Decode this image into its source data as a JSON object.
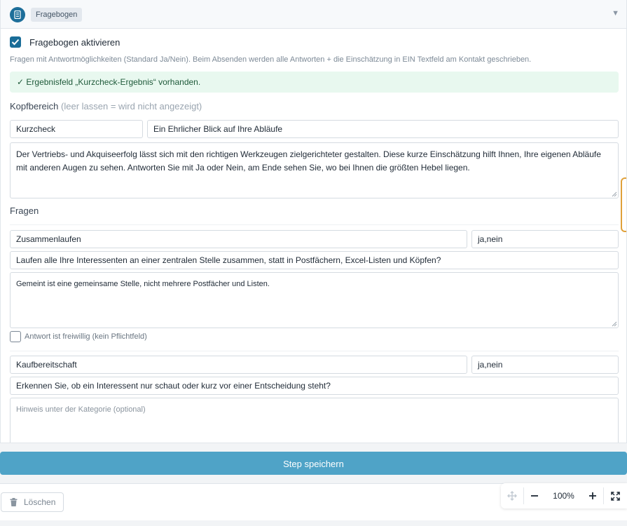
{
  "header": {
    "tag": "Fragebogen"
  },
  "activate": {
    "label": "Fragebogen aktivieren",
    "checked": true
  },
  "hint": "Fragen mit Antwortmöglichkeiten (Standard Ja/Nein). Beim Absenden werden alle Antworten + die Einschätzung in EIN Textfeld am Kontakt geschrieben.",
  "success": "✓ Ergebnisfeld „Kurzcheck-Ergebnis“ vorhanden.",
  "head_section": {
    "title": "Kopfbereich",
    "note": "(leer lassen = wird nicht angezeigt)",
    "label_value": "Kurzcheck",
    "headline_value": "Ein Ehrlicher Blick auf Ihre Abläufe",
    "intro": "Der Vertriebs- und Akquiseerfolg lässt sich mit den richtigen Werkzeugen zielgerichteter gestalten. Diese kurze Einschätzung hilft Ihnen, Ihre eigenen Abläufe mit anderen Augen zu sehen. Antworten Sie mit Ja oder Nein, am Ende sehen Sie, wo bei Ihnen die größten Hebel liegen."
  },
  "questions_title": "Fragen",
  "questions": [
    {
      "category": "Zusammenlaufen",
      "options": "ja,nein",
      "question": "Laufen alle Ihre Interessenten an einer zentralen Stelle zusammen, statt in Postfächern, Excel-Listen und Köpfen?",
      "note": "Gemeint ist eine gemeinsame Stelle, nicht mehrere Postfächer und Listen.",
      "optional_label": "Antwort ist freiwillig (kein Pflichtfeld)",
      "optional_checked": false
    },
    {
      "category": "Kaufbereitschaft",
      "options": "ja,nein",
      "question": "Erkennen Sie, ob ein Interessent nur schaut oder kurz vor einer Entscheidung steht?",
      "note_placeholder": "Hinweis unter der Kategorie (optional)"
    }
  ],
  "save_label": "Step speichern",
  "delete_label": "Löschen",
  "zoom": {
    "level": "100%"
  },
  "colors": {
    "accent": "#1a6d98",
    "save": "#4fa3c7",
    "success_bg": "#e8f8ef",
    "handle": "#e0a13a"
  }
}
